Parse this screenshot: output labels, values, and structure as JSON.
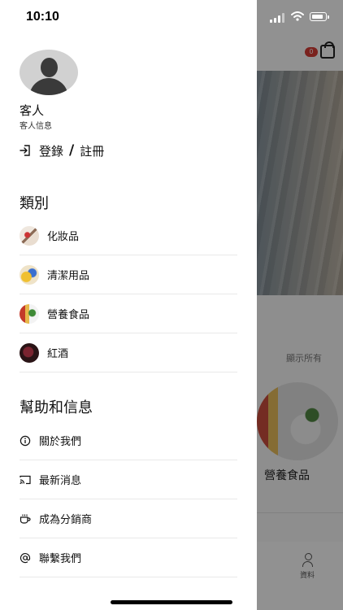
{
  "status_bar": {
    "time": "10:10"
  },
  "background": {
    "cart_count": "0",
    "show_all": "顯示所有",
    "product_label": "營養食品",
    "tab_profile": "資料"
  },
  "user": {
    "name": "客人",
    "info": "客人信息"
  },
  "login": {
    "login_label": "登錄",
    "separator": "/",
    "register_label": "註冊"
  },
  "categories": {
    "title": "類別",
    "items": [
      {
        "label": "化妝品",
        "thumb_color": "#d9c7b8"
      },
      {
        "label": "清潔用品",
        "thumb_color": "#e8a545"
      },
      {
        "label": "營養食品",
        "thumb_color": "#c95a3c"
      },
      {
        "label": "紅酒",
        "thumb_color": "#4a1e22"
      }
    ]
  },
  "help": {
    "title": "幫助和信息",
    "items": [
      {
        "label": "關於我們",
        "icon": "info-icon"
      },
      {
        "label": "最新消息",
        "icon": "cast-icon"
      },
      {
        "label": "成為分銷商",
        "icon": "cup-icon"
      },
      {
        "label": "聯繫我們",
        "icon": "at-icon"
      }
    ]
  },
  "colors": {
    "accent_badge": "#d23c34",
    "divider": "#e9e9e9"
  }
}
